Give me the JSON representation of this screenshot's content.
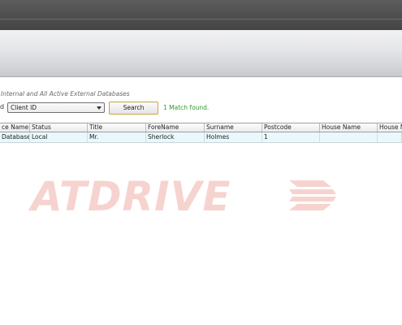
{
  "search": {
    "scope_label": "Internal and All Active External Databases",
    "field_label_fragment": "d",
    "field_selected": "Client ID",
    "button_label": "Search",
    "result_message": "1 Match found."
  },
  "grid": {
    "columns": [
      "ce Name",
      "Status",
      "Title",
      "ForeName",
      "Surname",
      "Postcode",
      "House Name",
      "House N"
    ],
    "rows": [
      [
        "Database",
        "Local",
        "Mr.",
        "Sherlock",
        "Holmes",
        "1",
        "",
        ""
      ]
    ]
  },
  "watermark": {
    "text": "ATDRIVE",
    "color": "#d93a2b"
  },
  "colors": {
    "title_bar": "#4d4d4d",
    "match_text": "#2e9b2e",
    "button_border": "#c9a642",
    "selected_row": "#eaf8fb"
  }
}
